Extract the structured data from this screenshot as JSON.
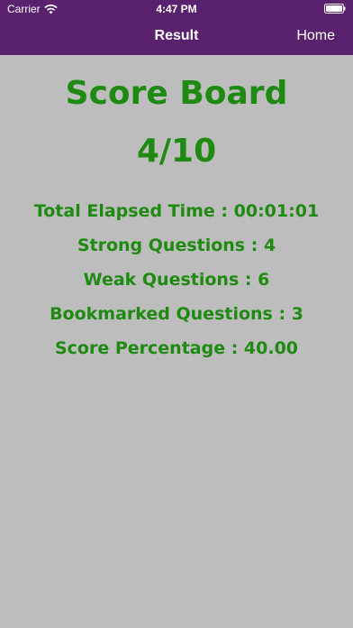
{
  "status_bar": {
    "carrier": "Carrier",
    "time": "4:47 PM"
  },
  "navigation": {
    "title": "Result",
    "home_label": "Home"
  },
  "main": {
    "title": "Score Board",
    "score": "4/10",
    "stats": [
      "Total Elapsed Time : 00:01:01",
      "Strong Questions : 4",
      "Weak Questions : 6",
      "Bookmarked Questions : 3",
      "Score Percentage : 40.00"
    ]
  },
  "colors": {
    "header_background": "#5a226e",
    "page_background": "#bdbdbd",
    "text_green": "#1e8a12",
    "header_text": "#ffffff"
  },
  "icons": [
    "wifi-icon",
    "battery-icon"
  ]
}
